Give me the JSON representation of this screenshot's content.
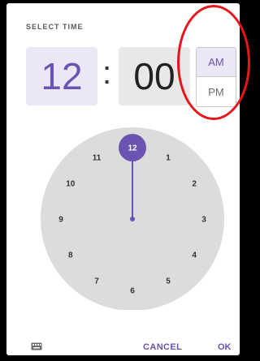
{
  "dialog": {
    "header": "SELECT TIME",
    "hour": "12",
    "separator": ":",
    "minute": "00",
    "am_label": "AM",
    "pm_label": "PM",
    "selected_period": "AM"
  },
  "clock": {
    "selected_hour": "12",
    "numbers": [
      "12",
      "1",
      "2",
      "3",
      "4",
      "5",
      "6",
      "7",
      "8",
      "9",
      "10",
      "11"
    ]
  },
  "footer": {
    "keyboard_icon": "keyboard-icon",
    "cancel_label": "CANCEL",
    "ok_label": "OK"
  },
  "colors": {
    "accent": "#6a53b1",
    "accent_light": "#ece7f7",
    "annotation": "#e8141b",
    "dial_bg": "#dcdcdc"
  }
}
